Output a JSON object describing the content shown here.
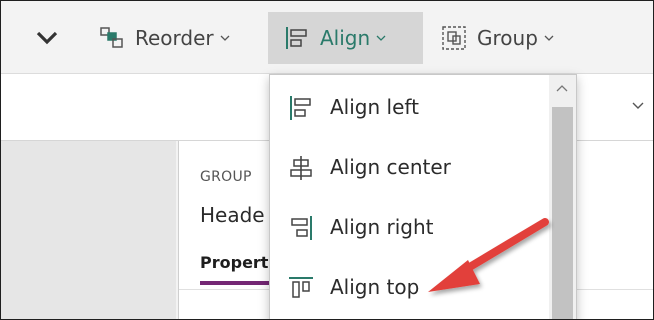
{
  "toolbar": {
    "reorder_label": "Reorder",
    "align_label": "Align",
    "group_label": "Group"
  },
  "properties": {
    "group_caption": "GROUP",
    "header_text": "Heade",
    "tab_label": "Propert"
  },
  "align_menu": {
    "items": [
      {
        "label": "Align left",
        "icon": "align-left-icon"
      },
      {
        "label": "Align center",
        "icon": "align-center-icon"
      },
      {
        "label": "Align right",
        "icon": "align-right-icon"
      },
      {
        "label": "Align top",
        "icon": "align-top-icon"
      }
    ]
  },
  "colors": {
    "accent_green": "#2a7a6a",
    "tab_underline": "#742774",
    "annotation_red": "#e2413b"
  }
}
